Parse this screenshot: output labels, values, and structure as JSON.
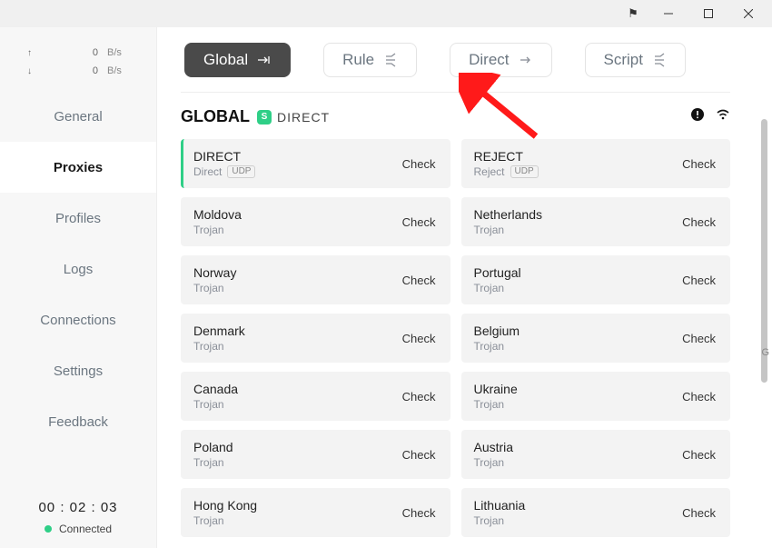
{
  "titlebar": {
    "pin": "⚑"
  },
  "net": {
    "up_arrow": "↑",
    "up_val": "0",
    "up_unit": "B/s",
    "down_arrow": "↓",
    "down_val": "0",
    "down_unit": "B/s"
  },
  "nav": {
    "general": "General",
    "proxies": "Proxies",
    "profiles": "Profiles",
    "logs": "Logs",
    "connections": "Connections",
    "settings": "Settings",
    "feedback": "Feedback"
  },
  "status": {
    "timer": "00 : 02 : 03",
    "label": "Connected"
  },
  "modes": {
    "global": "Global",
    "rule": "Rule",
    "direct": "Direct",
    "script": "Script"
  },
  "group": {
    "title": "GLOBAL",
    "badge": "S",
    "selected": "DIRECT"
  },
  "check_label": "Check",
  "udp_label": "UDP",
  "proxies": [
    {
      "name": "DIRECT",
      "sub": "Direct",
      "udp": true,
      "selected": true
    },
    {
      "name": "REJECT",
      "sub": "Reject",
      "udp": true,
      "selected": false
    },
    {
      "name": "Moldova",
      "sub": "Trojan",
      "udp": false,
      "selected": false
    },
    {
      "name": "Netherlands",
      "sub": "Trojan",
      "udp": false,
      "selected": false
    },
    {
      "name": "Norway",
      "sub": "Trojan",
      "udp": false,
      "selected": false
    },
    {
      "name": "Portugal",
      "sub": "Trojan",
      "udp": false,
      "selected": false
    },
    {
      "name": "Denmark",
      "sub": "Trojan",
      "udp": false,
      "selected": false
    },
    {
      "name": "Belgium",
      "sub": "Trojan",
      "udp": false,
      "selected": false
    },
    {
      "name": "Canada",
      "sub": "Trojan",
      "udp": false,
      "selected": false
    },
    {
      "name": "Ukraine",
      "sub": "Trojan",
      "udp": false,
      "selected": false
    },
    {
      "name": "Poland",
      "sub": "Trojan",
      "udp": false,
      "selected": false
    },
    {
      "name": "Austria",
      "sub": "Trojan",
      "udp": false,
      "selected": false
    },
    {
      "name": "Hong Kong",
      "sub": "Trojan",
      "udp": false,
      "selected": false
    },
    {
      "name": "Lithuania",
      "sub": "Trojan",
      "udp": false,
      "selected": false
    }
  ],
  "scroll_letter": "G"
}
